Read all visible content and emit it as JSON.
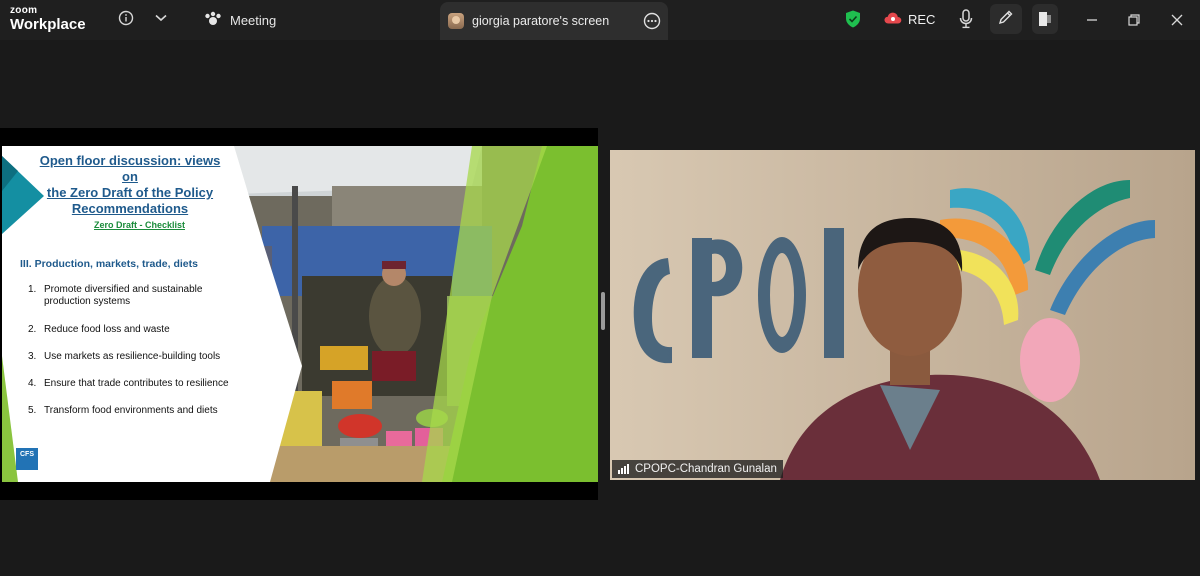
{
  "app": {
    "brand_top": "zoom",
    "brand_bottom": "Workplace"
  },
  "toolbar": {
    "meeting_label": "Meeting",
    "share_tab_label": "giorgia paratore's screen",
    "rec_label": "REC",
    "icons": [
      "info-icon",
      "chevron-down-icon",
      "meeting-icon",
      "more-icon",
      "shield-icon",
      "cloud-record-icon",
      "mic-icon",
      "annotate-icon",
      "exit-share-icon",
      "minimize-icon",
      "maximize-icon",
      "close-icon"
    ],
    "colors": {
      "shield": "#1fbf4f",
      "record": "#e5484d",
      "bar": "#1f1f1f"
    }
  },
  "slide": {
    "title_line1": "Open floor discussion: views on",
    "title_line2": "the Zero Draft of the Policy",
    "title_line3": "Recommendations",
    "subtitle": "Zero Draft - Checklist",
    "section": "III. Production, markets, trade, diets",
    "items": [
      {
        "num": "1.",
        "text": "Promote diversified and sustainable production systems"
      },
      {
        "num": "2.",
        "text": "Reduce food loss and waste"
      },
      {
        "num": "3.",
        "text": "Use markets as resilience-building tools"
      },
      {
        "num": "4.",
        "text": "Ensure that trade contributes to resilience"
      },
      {
        "num": "5.",
        "text": "Transform food environments and diets"
      }
    ],
    "logo_text": "CFS"
  },
  "participant": {
    "name": "CPOPC-Chandran Gunalan",
    "background_sign": "CPOPC"
  }
}
